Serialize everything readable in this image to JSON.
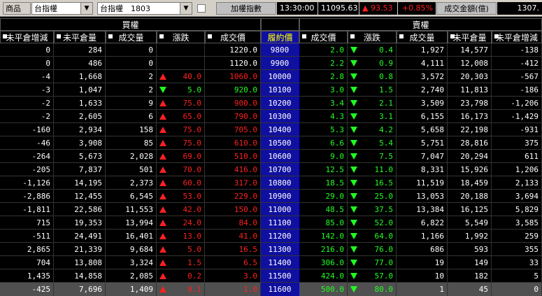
{
  "toolbar": {
    "product_label": "商品",
    "product_value": "台指權",
    "contract_value": "台指權　1803",
    "index_name": "加權指數",
    "time": "13:30:00",
    "index_value": "11095.63",
    "change": "93.53",
    "change_percent": "+0.85%",
    "turnover_label": "成交金額(億)",
    "turnover_value": "1307."
  },
  "table": {
    "call_header": "買權",
    "put_header": "賣權",
    "columns": [
      "未平倉增減",
      "未平倉量",
      "成交量",
      "漲跌",
      "成交價",
      "履約價",
      "成交價",
      "漲跌",
      "成交量",
      "未平倉量",
      "未平倉增減"
    ],
    "rows": [
      [
        "0",
        "284",
        "0",
        "",
        "",
        "1220.0",
        "9800",
        "2.0",
        "dn",
        "0.4",
        "1,927",
        "14,577",
        "-138"
      ],
      [
        "0",
        "486",
        "0",
        "",
        "",
        "1120.0",
        "9900",
        "2.2",
        "dn",
        "0.9",
        "4,111",
        "12,008",
        "-412"
      ],
      [
        "-4",
        "1,668",
        "2",
        "up",
        "40.0",
        "1060.0",
        "10000",
        "2.8",
        "dn",
        "0.8",
        "3,572",
        "20,303",
        "-567"
      ],
      [
        "-3",
        "1,047",
        "2",
        "dn",
        "5.0",
        "920.0",
        "10100",
        "3.0",
        "dn",
        "1.5",
        "2,740",
        "11,813",
        "-186"
      ],
      [
        "-2",
        "1,633",
        "9",
        "up",
        "75.0",
        "900.0",
        "10200",
        "3.4",
        "dn",
        "2.1",
        "3,509",
        "23,798",
        "-1,206"
      ],
      [
        "-2",
        "2,605",
        "6",
        "up",
        "65.0",
        "790.0",
        "10300",
        "4.3",
        "dn",
        "3.1",
        "6,155",
        "16,173",
        "-1,429"
      ],
      [
        "-160",
        "2,934",
        "158",
        "up",
        "75.0",
        "705.0",
        "10400",
        "5.3",
        "dn",
        "4.2",
        "5,658",
        "22,198",
        "-931"
      ],
      [
        "-46",
        "3,908",
        "85",
        "up",
        "75.0",
        "610.0",
        "10500",
        "6.6",
        "dn",
        "5.4",
        "5,751",
        "28,816",
        "375"
      ],
      [
        "-264",
        "5,673",
        "2,028",
        "up",
        "69.0",
        "510.0",
        "10600",
        "9.0",
        "dn",
        "7.5",
        "7,047",
        "20,294",
        "611"
      ],
      [
        "-205",
        "7,837",
        "501",
        "up",
        "70.0",
        "416.0",
        "10700",
        "12.5",
        "dn",
        "11.0",
        "8,331",
        "15,926",
        "1,206"
      ],
      [
        "-1,126",
        "14,195",
        "2,373",
        "up",
        "60.0",
        "317.0",
        "10800",
        "18.5",
        "dn",
        "16.5",
        "11,519",
        "18,459",
        "2,133"
      ],
      [
        "-2,886",
        "12,455",
        "6,545",
        "up",
        "53.0",
        "229.0",
        "10900",
        "29.0",
        "dn",
        "25.0",
        "13,053",
        "20,188",
        "3,694"
      ],
      [
        "-1,811",
        "22,586",
        "11,553",
        "up",
        "42.0",
        "150.0",
        "11000",
        "48.5",
        "dn",
        "37.5",
        "13,384",
        "16,125",
        "5,829"
      ],
      [
        "715",
        "19,353",
        "13,994",
        "up",
        "24.0",
        "84.0",
        "11100",
        "85.0",
        "dn",
        "52.0",
        "6,822",
        "5,549",
        "3,585"
      ],
      [
        "-511",
        "24,491",
        "16,401",
        "up",
        "13.0",
        "41.0",
        "11200",
        "142.0",
        "dn",
        "64.0",
        "1,166",
        "1,992",
        "259"
      ],
      [
        "2,865",
        "21,339",
        "9,684",
        "up",
        "5.0",
        "16.5",
        "11300",
        "216.0",
        "dn",
        "76.0",
        "686",
        "593",
        "355"
      ],
      [
        "704",
        "13,808",
        "3,324",
        "up",
        "1.5",
        "6.5",
        "11400",
        "306.0",
        "dn",
        "77.0",
        "19",
        "149",
        "33"
      ],
      [
        "1,435",
        "14,858",
        "2,085",
        "up",
        "0.2",
        "3.0",
        "11500",
        "424.0",
        "dn",
        "57.0",
        "10",
        "182",
        "5"
      ],
      [
        "-425",
        "7,696",
        "1,409",
        "up",
        "0.1",
        "1.0",
        "11600",
        "500.0",
        "dn",
        "80.0",
        "1",
        "45",
        "0"
      ]
    ]
  },
  "colors": {
    "up": "#ff2020",
    "down": "#20ff20",
    "strike_bg": "#1010a0",
    "strike_header_text": "#ffff00"
  }
}
